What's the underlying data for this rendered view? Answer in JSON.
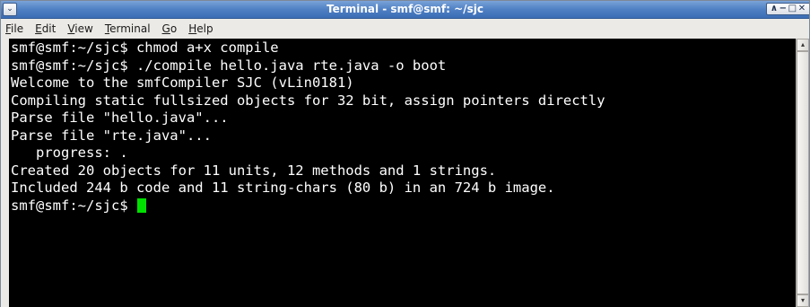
{
  "window": {
    "title": "Terminal - smf@smf: ~/sjc",
    "menu_button_glyph": "⌄",
    "controls": {
      "minimize": "∧",
      "shade": "−",
      "maximize": "□",
      "close": "✕"
    }
  },
  "menubar": {
    "items": [
      {
        "mnemonic": "F",
        "rest": "ile"
      },
      {
        "mnemonic": "E",
        "rest": "dit"
      },
      {
        "mnemonic": "V",
        "rest": "iew"
      },
      {
        "mnemonic": "T",
        "rest": "erminal"
      },
      {
        "mnemonic": "G",
        "rest": "o"
      },
      {
        "mnemonic": "H",
        "rest": "elp"
      }
    ]
  },
  "terminal": {
    "lines": [
      "smf@smf:~/sjc$ chmod a+x compile",
      "smf@smf:~/sjc$ ./compile hello.java rte.java -o boot",
      "Welcome to the smfCompiler SJC (vLin0181)",
      "Compiling static fullsized objects for 32 bit, assign pointers directly",
      "Parse file \"hello.java\"...",
      "Parse file \"rte.java\"...",
      "   progress: .",
      "Created 20 objects for 11 units, 12 methods and 1 strings.",
      "Included 244 b code and 11 string-chars (80 b) in an 724 b image."
    ],
    "prompt": "smf@smf:~/sjc$ ",
    "cursor_color": "#00e000",
    "background": "#000000",
    "foreground": "#ffffff"
  },
  "scrollbar": {
    "up_glyph": "▴",
    "down_glyph": "▾"
  }
}
